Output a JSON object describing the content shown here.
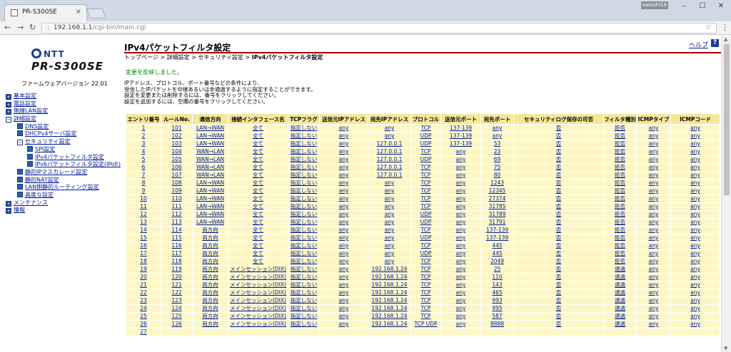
{
  "browser": {
    "tab_title": "PR-S300SE",
    "tab_close": "×",
    "user_badge": "satoshi19",
    "win_min": "–",
    "win_max": "☐",
    "win_close": "✕",
    "nav_back": "←",
    "nav_forward": "→",
    "nav_reload": "↻",
    "url_host": "192.168.1.1",
    "url_path": "/cgi-bin/main.cgi",
    "url_info_icon": "ⓘ",
    "bookmark_icon": "☆",
    "menu_icon": "⋮"
  },
  "sidebar": {
    "logo_brand": "NTT",
    "logo_model": "PR-S300SE",
    "firmware": "ファームウェアバージョン 22.01",
    "items": [
      {
        "label": "基本設定",
        "level": 1,
        "marker": "plus"
      },
      {
        "label": "電話設定",
        "level": 1,
        "marker": "plus"
      },
      {
        "label": "無線LAN設定",
        "level": 1,
        "marker": "plus"
      },
      {
        "label": "詳細設定",
        "level": 1,
        "marker": "minus"
      },
      {
        "label": "DNS設定",
        "level": 2,
        "marker": "leaf"
      },
      {
        "label": "DHCPv4サーバ設定",
        "level": 2,
        "marker": "leaf"
      },
      {
        "label": "セキュリティ設定",
        "level": 2,
        "marker": "minus"
      },
      {
        "label": "SPI設定",
        "level": 3,
        "marker": "leaf"
      },
      {
        "label": "IPv4パケットフィルタ設定",
        "level": 3,
        "marker": "leaf"
      },
      {
        "label": "IPv6パケットフィルタ設定(IPoE)",
        "level": 3,
        "marker": "leaf"
      },
      {
        "label": "静的IPマスカレード設定",
        "level": 2,
        "marker": "leaf"
      },
      {
        "label": "静的NAT設定",
        "level": 2,
        "marker": "leaf"
      },
      {
        "label": "LAN側静的ルーティング設定",
        "level": 2,
        "marker": "leaf"
      },
      {
        "label": "高度な設定",
        "level": 2,
        "marker": "leaf"
      },
      {
        "label": "メンテナンス",
        "level": 1,
        "marker": "plus"
      },
      {
        "label": "情報",
        "level": 1,
        "marker": "plus"
      }
    ]
  },
  "main": {
    "title": "IPv4パケットフィルタ設定",
    "help_label": "ヘルプ",
    "help_icon": "?",
    "breadcrumb": {
      "trail": "トップページ > 詳細設定 > セキュリティ設定 > ",
      "current": "IPv4パケットフィルタ設定"
    },
    "status": "変更を反映しました。",
    "description": [
      "IPアドレス、プロトコル、ポート番号などの条件により、",
      "受信したIPパケットを中継あるいは非通過するように指定することができます。",
      "設定を変更または削除するには、番号をクリックしてください。",
      "設定を追加するには、空欄の番号をクリックしてください。"
    ]
  },
  "table": {
    "headers": [
      "エントリ番号",
      "ルールNo.",
      "通信方向",
      "接続インタフェース名",
      "TCPフラグ",
      "送信元IPアドレス",
      "宛先IPアドレス",
      "プロトコル",
      "送信元ポート",
      "宛先ポート",
      "セキュリティログ保存の可否",
      "フィルタ種別",
      "ICMPタイプ",
      "ICMPコード"
    ],
    "rows": [
      [
        "1",
        "101",
        "LAN→WAN",
        "全て",
        "指定しない",
        "any",
        "any",
        "TCP",
        "137-139",
        "any",
        "否",
        "拒否",
        "any",
        "any"
      ],
      [
        "2",
        "102",
        "LAN→WAN",
        "全て",
        "指定しない",
        "any",
        "any",
        "UDP",
        "137-139",
        "any",
        "否",
        "拒否",
        "any",
        "any"
      ],
      [
        "3",
        "103",
        "LAN→WAN",
        "全て",
        "指定しない",
        "any",
        "127.0.0.1",
        "UDP",
        "137-139",
        "53",
        "否",
        "拒否",
        "any",
        "any"
      ],
      [
        "4",
        "104",
        "WAN→LAN",
        "全て",
        "指定しない",
        "any",
        "127.0.0.1",
        "TCP",
        "any",
        "23",
        "否",
        "拒否",
        "any",
        "any"
      ],
      [
        "5",
        "105",
        "WAN→LAN",
        "全て",
        "指定しない",
        "any",
        "127.0.0.1",
        "UDP",
        "any",
        "69",
        "否",
        "拒否",
        "any",
        "any"
      ],
      [
        "6",
        "106",
        "WAN→LAN",
        "全て",
        "指定しない",
        "any",
        "127.0.0.1",
        "TCP",
        "any",
        "75",
        "否",
        "拒否",
        "any",
        "any"
      ],
      [
        "7",
        "107",
        "WAN→LAN",
        "全て",
        "指定しない",
        "any",
        "127.0.0.1",
        "TCP",
        "any",
        "80",
        "否",
        "拒否",
        "any",
        "any"
      ],
      [
        "8",
        "108",
        "LAN→WAN",
        "全て",
        "指定しない",
        "any",
        "any",
        "TCP",
        "any",
        "1243",
        "否",
        "拒否",
        "any",
        "any"
      ],
      [
        "9",
        "109",
        "LAN→WAN",
        "全て",
        "指定しない",
        "any",
        "any",
        "TCP",
        "any",
        "12345",
        "否",
        "拒否",
        "any",
        "any"
      ],
      [
        "10",
        "110",
        "LAN→WAN",
        "全て",
        "指定しない",
        "any",
        "any",
        "TCP",
        "any",
        "27374",
        "否",
        "拒否",
        "any",
        "any"
      ],
      [
        "11",
        "111",
        "LAN→WAN",
        "全て",
        "指定しない",
        "any",
        "any",
        "TCP",
        "any",
        "31785",
        "否",
        "拒否",
        "any",
        "any"
      ],
      [
        "12",
        "112",
        "LAN→WAN",
        "全て",
        "指定しない",
        "any",
        "any",
        "UDP",
        "any",
        "31789",
        "否",
        "拒否",
        "any",
        "any"
      ],
      [
        "13",
        "113",
        "LAN→WAN",
        "全て",
        "指定しない",
        "any",
        "any",
        "UDP",
        "any",
        "31791",
        "否",
        "拒否",
        "any",
        "any"
      ],
      [
        "14",
        "114",
        "両方向",
        "全て",
        "指定しない",
        "any",
        "any",
        "TCP",
        "any",
        "137-139",
        "否",
        "拒否",
        "any",
        "any"
      ],
      [
        "15",
        "115",
        "両方向",
        "全て",
        "指定しない",
        "any",
        "any",
        "UDP",
        "any",
        "137-139",
        "否",
        "拒否",
        "any",
        "any"
      ],
      [
        "16",
        "116",
        "両方向",
        "全て",
        "指定しない",
        "any",
        "any",
        "TCP",
        "any",
        "445",
        "否",
        "拒否",
        "any",
        "any"
      ],
      [
        "17",
        "117",
        "両方向",
        "全て",
        "指定しない",
        "any",
        "any",
        "UDP",
        "any",
        "445",
        "否",
        "拒否",
        "any",
        "any"
      ],
      [
        "18",
        "118",
        "両方向",
        "全て",
        "指定しない",
        "any",
        "any",
        "TCP",
        "any",
        "2049",
        "否",
        "拒否",
        "any",
        "any"
      ],
      [
        "19",
        "119",
        "両方向",
        "メインセッション(DIX)",
        "指定しない",
        "any",
        "192.168.1.24",
        "TCP",
        "any",
        "25",
        "否",
        "通過",
        "any",
        "any"
      ],
      [
        "20",
        "120",
        "両方向",
        "メインセッション(DIX)",
        "指定しない",
        "any",
        "192.168.1.24",
        "TCP",
        "any",
        "110",
        "否",
        "通過",
        "any",
        "any"
      ],
      [
        "21",
        "121",
        "両方向",
        "メインセッション(DIX)",
        "指定しない",
        "any",
        "192.168.1.24",
        "TCP",
        "any",
        "143",
        "否",
        "通過",
        "any",
        "any"
      ],
      [
        "22",
        "122",
        "両方向",
        "メインセッション(DIX)",
        "指定しない",
        "any",
        "192.168.1.24",
        "TCP",
        "any",
        "465",
        "否",
        "通過",
        "any",
        "any"
      ],
      [
        "23",
        "123",
        "両方向",
        "メインセッション(DIX)",
        "指定しない",
        "any",
        "192.168.1.24",
        "TCP",
        "any",
        "993",
        "否",
        "通過",
        "any",
        "any"
      ],
      [
        "24",
        "124",
        "両方向",
        "メインセッション(DIX)",
        "指定しない",
        "any",
        "192.168.1.24",
        "TCP",
        "any",
        "995",
        "否",
        "通過",
        "any",
        "any"
      ],
      [
        "25",
        "125",
        "両方向",
        "メインセッション(DIX)",
        "指定しない",
        "any",
        "192.168.1.24",
        "TCP",
        "any",
        "587",
        "否",
        "通過",
        "any",
        "any"
      ],
      [
        "26",
        "126",
        "両方向",
        "メインセッション(DIX)",
        "指定しない",
        "any",
        "192.168.1.24",
        "TCP UDP",
        "any",
        "8888",
        "否",
        "通過",
        "any",
        "any"
      ],
      [
        "27",
        "",
        "",
        "",
        "",
        "",
        "",
        "",
        "",
        "",
        "",
        "",
        "",
        ""
      ]
    ]
  },
  "scrollbar": {
    "up": "▲",
    "down": "▼"
  }
}
